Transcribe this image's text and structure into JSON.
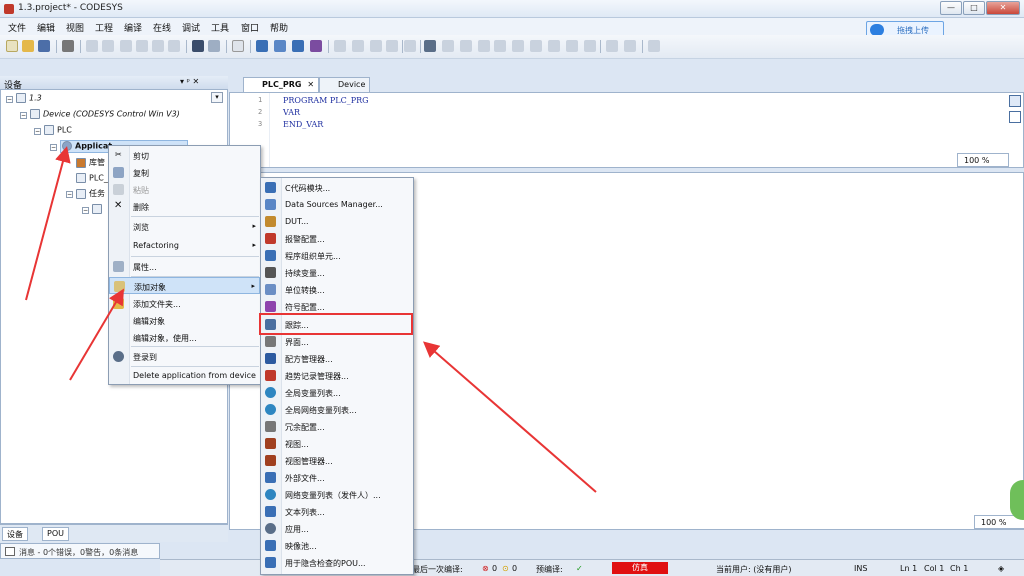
{
  "window": {
    "title": "1.3.project* - CODESYS",
    "min": "—",
    "max": "□",
    "close": "✕"
  },
  "menu": [
    "文件",
    "编辑",
    "视图",
    "工程",
    "编译",
    "在线",
    "调试",
    "工具",
    "窗口",
    "帮助"
  ],
  "upload_button": "拖拽上传",
  "device_panel": {
    "title": "设备",
    "pin": "▾ ᵖ ✕",
    "tree": [
      {
        "label": "1.3",
        "italic": true
      },
      {
        "label": "Device (CODESYS Control Win V3)",
        "italic": true
      },
      {
        "label": "PLC"
      },
      {
        "label": "Applicat"
      },
      {
        "label": "库管"
      },
      {
        "label": "PLC_"
      },
      {
        "label": "任务"
      }
    ]
  },
  "bottom_tabs": [
    "设备",
    "POU"
  ],
  "messages": "消息 - 0个错误，0警告，0条消息",
  "editor": {
    "tabs": [
      "PLC_PRG",
      "Device"
    ],
    "line_numbers": [
      "1",
      "2",
      "3"
    ],
    "code": [
      "PROGRAM PLC_PRG",
      "VAR",
      "END_VAR"
    ],
    "zoom_top": "100 %",
    "zoom_bottom": "100 %"
  },
  "context_menu_1": [
    {
      "label": "剪切",
      "icon": "scissors-icon"
    },
    {
      "label": "复制",
      "icon": "copy-icon"
    },
    {
      "label": "粘贴",
      "icon": "paste-icon",
      "disabled": true
    },
    {
      "label": "删除",
      "icon": "delete-icon"
    },
    {
      "label": "浏览",
      "submenu": true
    },
    {
      "label": "Refactoring",
      "submenu": true
    },
    {
      "label": "属性...",
      "icon": "properties-icon"
    },
    {
      "label": "添加对象",
      "icon": "add-object-icon",
      "submenu": true,
      "highlighted": true
    },
    {
      "label": "添加文件夹...",
      "icon": "folder-icon"
    },
    {
      "label": "编辑对象"
    },
    {
      "label": "编辑对象，使用..."
    },
    {
      "label": "登录到",
      "icon": "login-icon"
    },
    {
      "label": "Delete application from device"
    }
  ],
  "context_menu_2": [
    {
      "label": "C代码模块...",
      "color": "#3a6fb5"
    },
    {
      "label": "Data Sources Manager...",
      "color": "#5a87c6"
    },
    {
      "label": "DUT...",
      "color": "#c28a2e"
    },
    {
      "label": "报警配置...",
      "color": "#c0392b"
    },
    {
      "label": "程序组织单元...",
      "color": "#3a6fb5"
    },
    {
      "label": "持续变量...",
      "color": "#555555"
    },
    {
      "label": "单位转换...",
      "color": "#6b8ec4"
    },
    {
      "label": "符号配置...",
      "color": "#8e44ad"
    },
    {
      "label": "跟踪...",
      "color": "#4a6fa0"
    },
    {
      "label": "界面...",
      "color": "#777777"
    },
    {
      "label": "配方管理器...",
      "color": "#2c5aa0"
    },
    {
      "label": "趋势记录管理器...",
      "color": "#c0392b"
    },
    {
      "label": "全局变量列表...",
      "color": "#2e86c1"
    },
    {
      "label": "全局网络变量列表...",
      "color": "#2e86c1"
    },
    {
      "label": "冗余配置...",
      "color": "#777777"
    },
    {
      "label": "视图...",
      "color": "#a04020"
    },
    {
      "label": "视图管理器...",
      "color": "#a04020"
    },
    {
      "label": "外部文件...",
      "color": "#3a6fb5"
    },
    {
      "label": "网络变量列表（发件人）...",
      "color": "#2e86c1"
    },
    {
      "label": "文本列表...",
      "color": "#3a6fb5"
    },
    {
      "label": "应用...",
      "color": "#5a6e88"
    },
    {
      "label": "映像池...",
      "color": "#3a6fb5"
    },
    {
      "label": "用于隐含检查的POU...",
      "color": "#3a6fb5"
    }
  ],
  "status": {
    "last_compile": "最后一次编译:",
    "errors": "0",
    "warnings": "0",
    "precompile": "预编译:",
    "precompile_ok": "✓",
    "simulation": "仿真",
    "current_user": "当前用户: (没有用户)",
    "ins": "INS",
    "ln": "Ln 1",
    "col": "Col 1",
    "ch": "Ch 1"
  },
  "colors": {
    "accent": "#2d7fe0",
    "highlight_border": "#e83535",
    "menu_highlight": "#cfe3f8"
  }
}
